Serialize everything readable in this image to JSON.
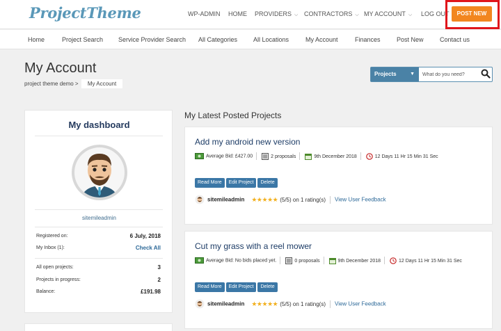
{
  "brand": {
    "logo_text": "ProjectTheme"
  },
  "topnav": {
    "items": [
      "WP-ADMIN",
      "HOME",
      "PROVIDERS",
      "CONTRACTORS",
      "MY ACCOUNT",
      "LOG OUT"
    ],
    "post_new": "POST NEW"
  },
  "subnav": {
    "items": [
      "Home",
      "Project Search",
      "Service Provider Search",
      "All Categories",
      "All Locations",
      "My Account",
      "Finances",
      "Post New",
      "Contact us"
    ]
  },
  "page": {
    "title": "My Account",
    "breadcrumb_root": "project theme demo >",
    "breadcrumb_current": "My Account"
  },
  "search": {
    "select_label": "Projects",
    "placeholder": "What do you need?"
  },
  "dashboard": {
    "title": "My dashboard",
    "username": "sitemileadmin",
    "registered_label": "Registered on:",
    "registered_value": "6 July, 2018",
    "inbox_label": "My Inbox (1):",
    "inbox_value": "Check All",
    "open_projects_label": "All open projects:",
    "open_projects_value": "3",
    "in_progress_label": "Projects in progress:",
    "in_progress_value": "2",
    "balance_label": "Balance:",
    "balance_value": "£191.98"
  },
  "projects_heading": "My Latest Posted Projects",
  "projects": [
    {
      "title": "Add my android new version",
      "bid": "Average Bid: £427.00",
      "proposals": "2 proposals",
      "date": "9th December 2018",
      "time_left": "12 Days 11 Hr 15 Min 31 Sec",
      "owner": "sitemileadmin",
      "rating": "(5/5) on 1 rating(s)",
      "feedback": "View User Feedback"
    },
    {
      "title": "Cut my grass with a reel mower",
      "bid": "Average Bid: No bids placed yet.",
      "proposals": "0 proposals",
      "date": "9th December 2018",
      "time_left": "12 Days 11 Hr 15 Min 31 Sec",
      "owner": "sitemileadmin",
      "rating": "(5/5) on 1 rating(s)",
      "feedback": "View User Feedback"
    }
  ],
  "buttons": {
    "read_more": "Read More",
    "edit": "Edit Project",
    "delete": "Delete"
  },
  "stars": "★★★★★",
  "colors": {
    "accent": "#f2861f",
    "highlight_frame": "#e0151b",
    "primary": "#3b77a6",
    "title": "#1d3c66"
  }
}
